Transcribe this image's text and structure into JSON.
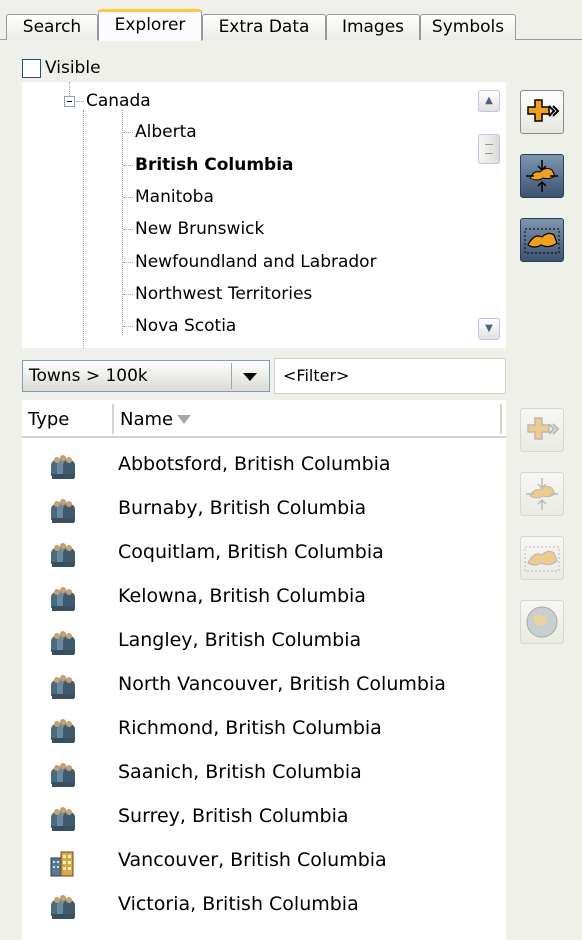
{
  "tabs": [
    {
      "label": "Search",
      "active": false
    },
    {
      "label": "Explorer",
      "active": true
    },
    {
      "label": "Extra Data",
      "active": false
    },
    {
      "label": "Images",
      "active": false
    },
    {
      "label": "Symbols",
      "active": false
    }
  ],
  "visible_checkbox": {
    "label": "Visible",
    "checked": false
  },
  "tree": {
    "parent": {
      "label": "Canada",
      "expanded": true
    },
    "children": [
      {
        "label": "Alberta",
        "selected": false
      },
      {
        "label": "British Columbia",
        "selected": true
      },
      {
        "label": "Manitoba",
        "selected": false
      },
      {
        "label": "New Brunswick",
        "selected": false
      },
      {
        "label": "Newfoundland and Labrador",
        "selected": false
      },
      {
        "label": "Northwest Territories",
        "selected": false
      },
      {
        "label": "Nova Scotia",
        "selected": false
      }
    ]
  },
  "filter": {
    "category_value": "Towns > 100k",
    "placeholder": "<Filter>"
  },
  "list": {
    "columns": {
      "type": "Type",
      "name": "Name"
    },
    "sort": "name-descending",
    "rows": [
      {
        "icon": "town-icon",
        "name": "Abbotsford, British Columbia"
      },
      {
        "icon": "town-icon",
        "name": "Burnaby, British Columbia"
      },
      {
        "icon": "town-icon",
        "name": "Coquitlam, British Columbia"
      },
      {
        "icon": "town-icon",
        "name": "Kelowna, British Columbia"
      },
      {
        "icon": "town-icon",
        "name": "Langley, British Columbia"
      },
      {
        "icon": "town-icon",
        "name": "North Vancouver, British Columbia"
      },
      {
        "icon": "town-icon",
        "name": "Richmond, British Columbia"
      },
      {
        "icon": "town-icon",
        "name": "Saanich, British Columbia"
      },
      {
        "icon": "town-icon",
        "name": "Surrey, British Columbia"
      },
      {
        "icon": "city-icon",
        "name": "Vancouver, British Columbia"
      },
      {
        "icon": "town-icon",
        "name": "Victoria, British Columbia"
      }
    ]
  },
  "colors": {
    "active_tab_accent": "#ffc73c",
    "region_orange": "#f0a020",
    "tree_button_dark": "#3c5270"
  }
}
